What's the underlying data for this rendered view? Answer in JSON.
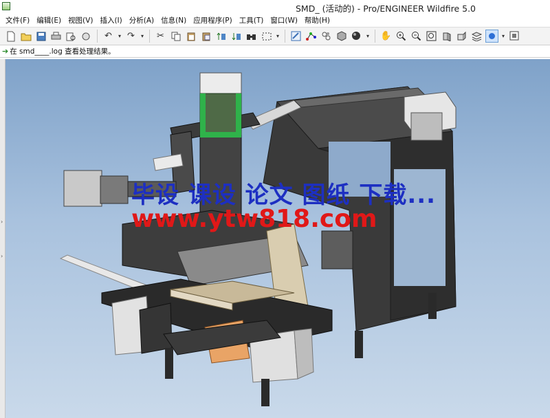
{
  "window": {
    "title": "SMD_ (活动的) - Pro/ENGINEER Wildfire 5.0"
  },
  "menu": [
    "文件(F)",
    "编辑(E)",
    "视图(V)",
    "插入(I)",
    "分析(A)",
    "信息(N)",
    "应用程序(P)",
    "工具(T)",
    "窗口(W)",
    "帮助(H)"
  ],
  "message": {
    "text": "在 smd____.log 查看处理结果。"
  },
  "watermark": {
    "line1": "毕设 课设 论文 图纸 下载...",
    "line2": "www.ytw818.com"
  },
  "toolbar_icons": [
    "new-icon",
    "open-icon",
    "save-icon",
    "print-icon",
    "preview-icon",
    "email-icon",
    "undo-icon",
    "redo-icon",
    "cut-icon",
    "copy-icon",
    "paste-icon",
    "paste-special-icon",
    "regenerate-icon",
    "regen-manager-icon",
    "find-icon",
    "select-box-icon",
    "repaint-icon",
    "spin-center-icon",
    "view-manager-icon",
    "saved-views-icon",
    "shading-icon",
    "pan-icon",
    "zoom-in-icon",
    "zoom-out-icon",
    "refit-icon",
    "reorient-icon",
    "named-views-icon",
    "layers-icon",
    "appearance-icon",
    "model-tree-icon"
  ],
  "colors": {
    "viewport_top": "#7fa2c9",
    "viewport_bottom": "#c9d9ea",
    "watermark_blue": "#1d2fc2",
    "watermark_red": "#e01818"
  }
}
